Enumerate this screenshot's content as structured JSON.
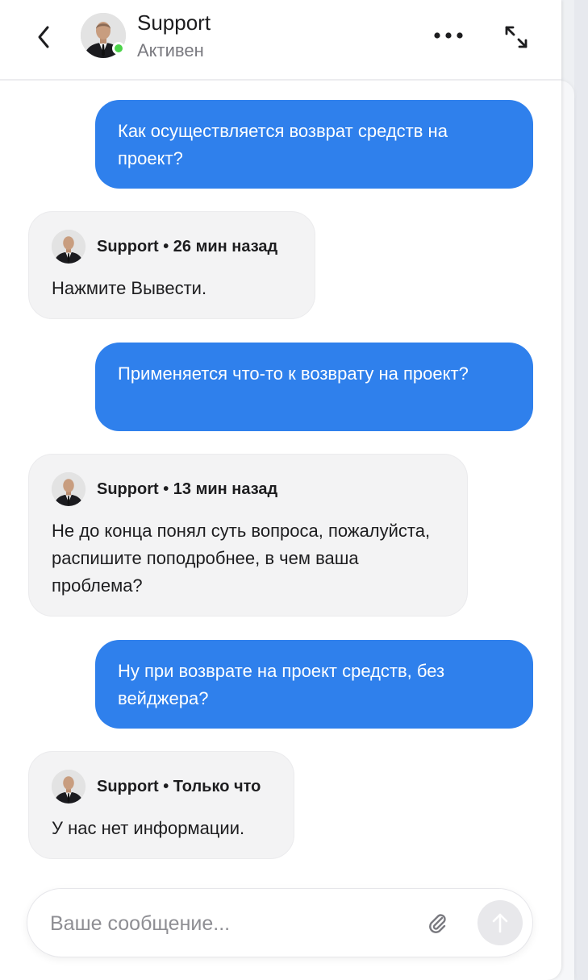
{
  "header": {
    "name": "Support",
    "status": "Активен"
  },
  "messages": [
    {
      "from": "user",
      "text": "Как осуществляется возврат средств на проект?"
    },
    {
      "from": "support",
      "meta": "Support • 26 мин назад",
      "text": "Нажмите Вывести."
    },
    {
      "from": "user",
      "text": "Применяется что-то к возврату на проект?"
    },
    {
      "from": "support",
      "meta": "Support • 13 мин назад",
      "text": "Не до конца понял суть вопроса, пожалуйста, распишите поподробнее, в чем ваша проблема?"
    },
    {
      "from": "user",
      "text": "Ну при возврате на проект средств, без вейджера?"
    },
    {
      "from": "support",
      "meta": "Support • Только что",
      "text": "У нас нет информации."
    }
  ],
  "composer": {
    "placeholder": "Ваше сообщение..."
  },
  "icons": {
    "back": "chevron-left-icon",
    "more": "more-horizontal-icon",
    "expand": "expand-arrows-icon",
    "attach": "paperclip-icon",
    "send": "arrow-up-icon"
  },
  "colors": {
    "user_bubble": "#2f80ec",
    "support_bubble": "#f3f3f4",
    "online": "#4cd34a"
  }
}
